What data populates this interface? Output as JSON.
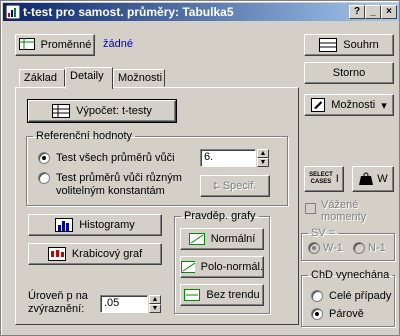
{
  "window": {
    "title": "t-test pro samost. průměry: Tabulka5"
  },
  "title_buttons": [
    "?",
    "_",
    "×"
  ],
  "variables": {
    "button": "Proměnné",
    "value": "žádné"
  },
  "right_buttons": {
    "summary": "Souhrn",
    "cancel": "Storno",
    "options": "Možnosti"
  },
  "tabs": [
    "Základ",
    "Detaily",
    "Možnosti"
  ],
  "compute_button": "Výpočet: t-testy",
  "reference": {
    "legend": "Referenční hodnoty",
    "opt1": "Test všech průměrů vůči",
    "value": "6.",
    "opt2_line1": "Test průměrů vůči různým",
    "opt2_line2": "volitelným konstantám",
    "specif": "Specif."
  },
  "histograms": "Histogramy",
  "boxplot": "Krabicový graf",
  "prob_graphs": {
    "legend": "Pravděp. grafy",
    "normal": "Normální",
    "half_normal": "Polo-normál.",
    "detrended": "Bez trendu"
  },
  "p_level": {
    "line1": "Úroveň p na",
    "line2": "zvýraznění:",
    "value": ".05"
  },
  "select_cases": {
    "line1": "SELECT",
    "line2": "CASES",
    "i": "I",
    "w": "W"
  },
  "weighted_moments": "Vážené\nmomenty",
  "sv": {
    "legend": "SV =",
    "w1": "W-1",
    "n1": "N-1"
  },
  "missing": {
    "legend": "ChD vynechána",
    "casewise": "Celé případy",
    "pairwise": "Párově"
  }
}
